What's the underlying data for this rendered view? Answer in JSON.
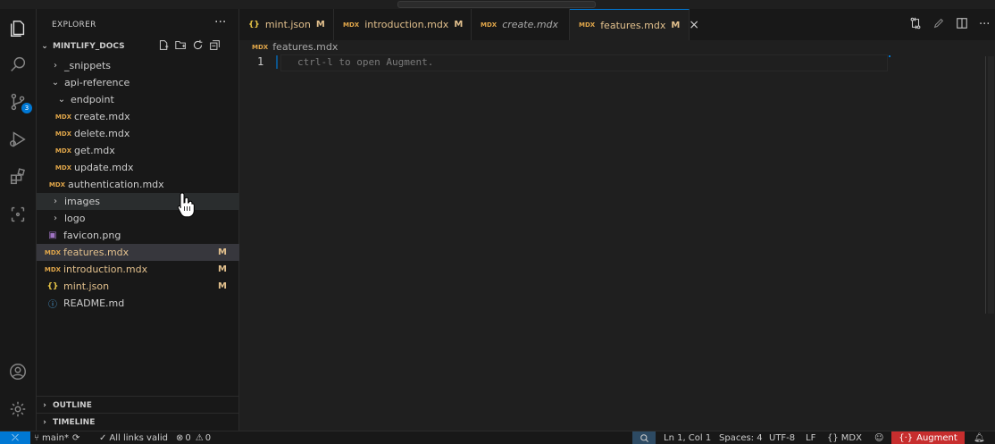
{
  "explorer": {
    "title": "EXPLORER",
    "more": "···",
    "workspace": "MINTLIFY_DOCS",
    "tree": [
      {
        "label": "_snippets",
        "type": "folder",
        "expanded": false,
        "mod": ""
      },
      {
        "label": "api-reference",
        "type": "folder",
        "expanded": true,
        "mod": ""
      },
      {
        "label": "endpoint",
        "type": "folder",
        "expanded": true,
        "mod": ""
      },
      {
        "label": "create.mdx",
        "type": "mdx",
        "mod": ""
      },
      {
        "label": "delete.mdx",
        "type": "mdx",
        "mod": ""
      },
      {
        "label": "get.mdx",
        "type": "mdx",
        "mod": ""
      },
      {
        "label": "update.mdx",
        "type": "mdx",
        "mod": ""
      },
      {
        "label": "authentication.mdx",
        "type": "mdx",
        "mod": ""
      },
      {
        "label": "images",
        "type": "folder",
        "expanded": false,
        "mod": ""
      },
      {
        "label": "logo",
        "type": "folder",
        "expanded": false,
        "mod": ""
      },
      {
        "label": "favicon.png",
        "type": "png",
        "mod": ""
      },
      {
        "label": "features.mdx",
        "type": "mdx",
        "mod": "M"
      },
      {
        "label": "introduction.mdx",
        "type": "mdx",
        "mod": "M"
      },
      {
        "label": "mint.json",
        "type": "json",
        "mod": "M"
      },
      {
        "label": "README.md",
        "type": "info",
        "mod": ""
      }
    ],
    "outline": "OUTLINE",
    "timeline": "TIMELINE"
  },
  "icons": {
    "mdx": "MDX",
    "json": "{}",
    "png": "▣",
    "info": "ⓘ"
  },
  "tabs": [
    {
      "label": "mint.json",
      "icon": "{}",
      "mod": "M",
      "italic": false,
      "active": false
    },
    {
      "label": "introduction.mdx",
      "icon": "MDX",
      "mod": "M",
      "italic": false,
      "active": false
    },
    {
      "label": "create.mdx",
      "icon": "MDX",
      "mod": "",
      "italic": true,
      "active": false
    },
    {
      "label": "features.mdx",
      "icon": "MDX",
      "mod": "M",
      "italic": false,
      "active": true,
      "close": "×"
    }
  ],
  "editor": {
    "breadcrumb": "features.mdx",
    "breadcrumb_icon": "MDX",
    "line_number": "1",
    "ghost_text": "ctrl-l to open Augment."
  },
  "status": {
    "branch": "main*",
    "links": "All links valid",
    "errors": "0",
    "warnings": "0",
    "position": "Ln 1, Col 1",
    "spaces": "Spaces: 4",
    "encoding": "UTF-8",
    "eol": "LF",
    "language": "MDX",
    "augment": "Augment"
  },
  "colors": {
    "accent": "#0078d4",
    "modified": "#e2c08d",
    "augment": "#c72e2e"
  }
}
